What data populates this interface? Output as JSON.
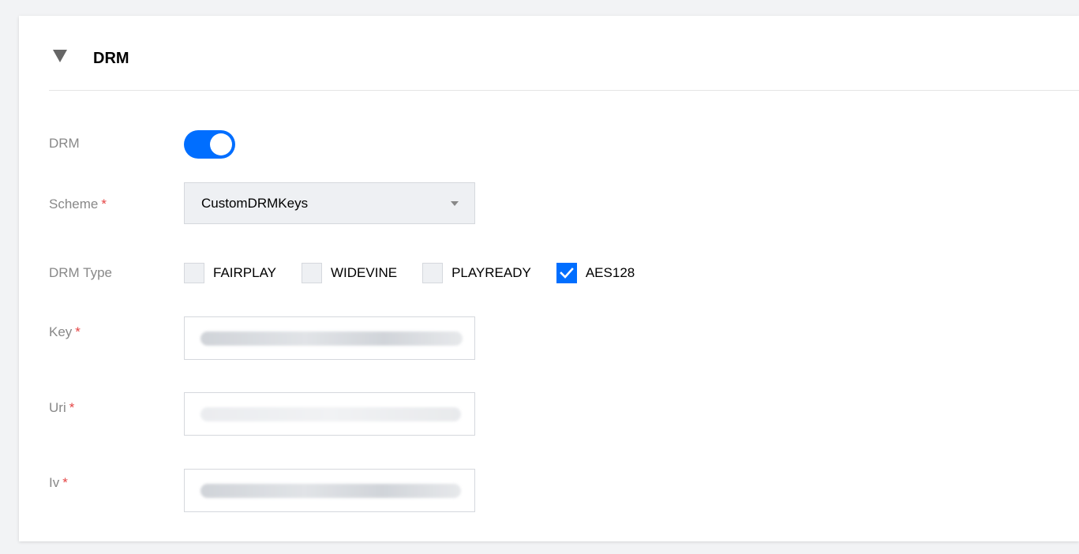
{
  "section": {
    "title": "DRM",
    "collapse_icon": "caret-down-icon"
  },
  "form": {
    "drm": {
      "label": "DRM",
      "enabled": true
    },
    "scheme": {
      "label": "Scheme",
      "required_mark": "*",
      "value": "CustomDRMKeys",
      "icon": "chevron-down-icon"
    },
    "drm_type": {
      "label": "DRM Type",
      "options": [
        {
          "label": "FAIRPLAY",
          "checked": false
        },
        {
          "label": "WIDEVINE",
          "checked": false
        },
        {
          "label": "PLAYREADY",
          "checked": false
        },
        {
          "label": "AES128",
          "checked": true
        }
      ]
    },
    "key": {
      "label": "Key",
      "required_mark": "*",
      "value_obscured": true
    },
    "uri": {
      "label": "Uri",
      "required_mark": "*",
      "value_obscured": true
    },
    "iv": {
      "label": "Iv",
      "required_mark": "*",
      "value_obscured": true
    }
  },
  "colors": {
    "accent": "#006eff",
    "required": "#e54545",
    "label": "#888888",
    "card_bg": "#ffffff",
    "page_bg": "#f2f3f5"
  }
}
